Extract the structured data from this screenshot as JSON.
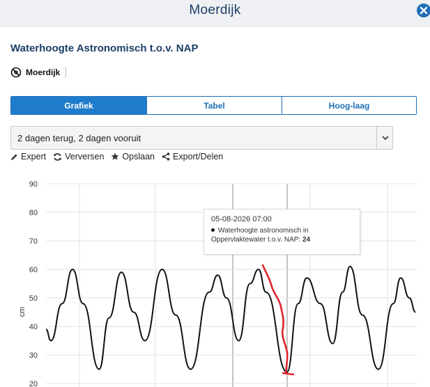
{
  "window": {
    "title": "Moerdijk"
  },
  "heading": "Waterhoogte Astronomisch t.o.v. NAP",
  "location": {
    "label": "Moerdijk"
  },
  "tabs": [
    {
      "label": "Grafiek",
      "active": true
    },
    {
      "label": "Tabel",
      "active": false
    },
    {
      "label": "Hoog-laag",
      "active": false
    }
  ],
  "range_select": {
    "value": "2 dagen terug, 2 dagen vooruit"
  },
  "toolbar": {
    "expert": "Expert",
    "refresh": "Verversen",
    "save": "Opslaan",
    "export": "Export/Delen"
  },
  "colors": {
    "accent": "#1f7ccb",
    "title": "#1d3f66",
    "series": "#111111",
    "annotation": "#e0242b"
  },
  "icons": [
    "close-icon",
    "location-icon",
    "chevron-down-icon",
    "pencil-icon",
    "refresh-icon",
    "star-icon",
    "share-icon"
  ],
  "tooltip": {
    "date": "05-08-2026 07:00",
    "series_text": "Waterhoogte astronomisch in Oppervlaktewater t.o.v. NAP: ",
    "value": "24"
  },
  "chart_data": {
    "type": "line",
    "ylabel": "cm",
    "ylim": [
      20,
      90
    ],
    "yticks": [
      20,
      30,
      40,
      50,
      60,
      70,
      80,
      90
    ],
    "grid": true,
    "series": [
      {
        "values": [
          {
            "x": 0.0,
            "y": 39
          },
          {
            "x": 0.4,
            "y": 35
          },
          {
            "x": 1.3,
            "y": 48
          },
          {
            "x": 2.15,
            "y": 60
          },
          {
            "x": 3.0,
            "y": 48
          },
          {
            "x": 4.3,
            "y": 25
          },
          {
            "x": 5.1,
            "y": 43
          },
          {
            "x": 6.1,
            "y": 59
          },
          {
            "x": 7.1,
            "y": 45
          },
          {
            "x": 8.0,
            "y": 35
          },
          {
            "x": 9.4,
            "y": 60
          },
          {
            "x": 10.5,
            "y": 44
          },
          {
            "x": 11.7,
            "y": 25
          },
          {
            "x": 13.2,
            "y": 52
          },
          {
            "x": 13.9,
            "y": 58
          },
          {
            "x": 14.6,
            "y": 50
          },
          {
            "x": 15.6,
            "y": 35
          },
          {
            "x": 16.5,
            "y": 55
          },
          {
            "x": 17.2,
            "y": 60
          },
          {
            "x": 17.8,
            "y": 52
          },
          {
            "x": 19.5,
            "y": 24
          },
          {
            "x": 20.4,
            "y": 48
          },
          {
            "x": 21.1,
            "y": 57
          },
          {
            "x": 22.2,
            "y": 48
          },
          {
            "x": 23.2,
            "y": 34
          },
          {
            "x": 24.0,
            "y": 52
          },
          {
            "x": 24.6,
            "y": 61
          },
          {
            "x": 25.6,
            "y": 44
          },
          {
            "x": 26.9,
            "y": 25
          },
          {
            "x": 28.1,
            "y": 48
          },
          {
            "x": 28.7,
            "y": 57
          },
          {
            "x": 29.4,
            "y": 50
          },
          {
            "x": 29.9,
            "y": 45
          }
        ]
      }
    ]
  }
}
